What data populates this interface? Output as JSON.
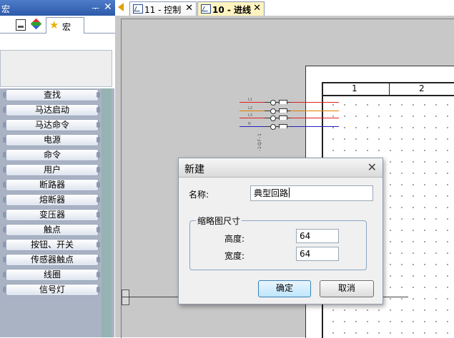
{
  "panel": {
    "title": "宏",
    "pin_glyph": "ᅮ",
    "close_glyph": "✕",
    "tab_macro_label": "宏",
    "items": [
      "查找",
      "马达启动",
      "马达命令",
      "电源",
      "命令",
      "用户",
      "断路器",
      "熔断器",
      "变压器",
      "触点",
      "按钮、开关",
      "传感器触点",
      "线圈",
      "信号灯"
    ]
  },
  "doc_tabs": [
    {
      "label": "11 - 控制",
      "close": "✕"
    },
    {
      "label": "10 - 进线",
      "close": "✕"
    }
  ],
  "sheet": {
    "ruler": [
      "1",
      "2"
    ]
  },
  "wire_labels": [
    "L1",
    "L2",
    "L3",
    "N"
  ],
  "wire_colors": {
    "red": "#e02020",
    "orange": "#e08000",
    "blue": "#2020c0"
  },
  "symbol_label": "-1QF-1",
  "dialog": {
    "title": "新建",
    "close_glyph": "✕",
    "name_label": "名称:",
    "name_value": "典型回路",
    "group_label": "缩略图尺寸",
    "height_label": "高度:",
    "height_value": "64",
    "width_label": "宽度:",
    "width_value": "64",
    "ok_label": "确定",
    "cancel_label": "取消"
  }
}
